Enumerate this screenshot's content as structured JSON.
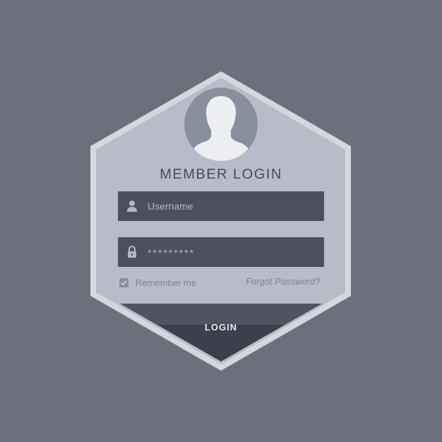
{
  "colors": {
    "background": "#6c707d",
    "card_border": "#d4d7df",
    "card_fill": "#b9bcc8",
    "field_bg": "#4c505e",
    "button_top": "#505462",
    "button_bottom": "#3d404c",
    "avatar_circle": "#8a8f9c",
    "avatar_silhouette": "#eceef2"
  },
  "login_form": {
    "title": "MEMBER LOGIN",
    "username": {
      "icon": "user-icon",
      "placeholder": "Username",
      "value": ""
    },
    "password": {
      "icon": "lock-icon",
      "masked_value": "*********"
    },
    "remember_me": {
      "label": "Remember me",
      "checked": true
    },
    "forgot_password": "Forgot Password?",
    "submit_label": "LOGIN"
  }
}
